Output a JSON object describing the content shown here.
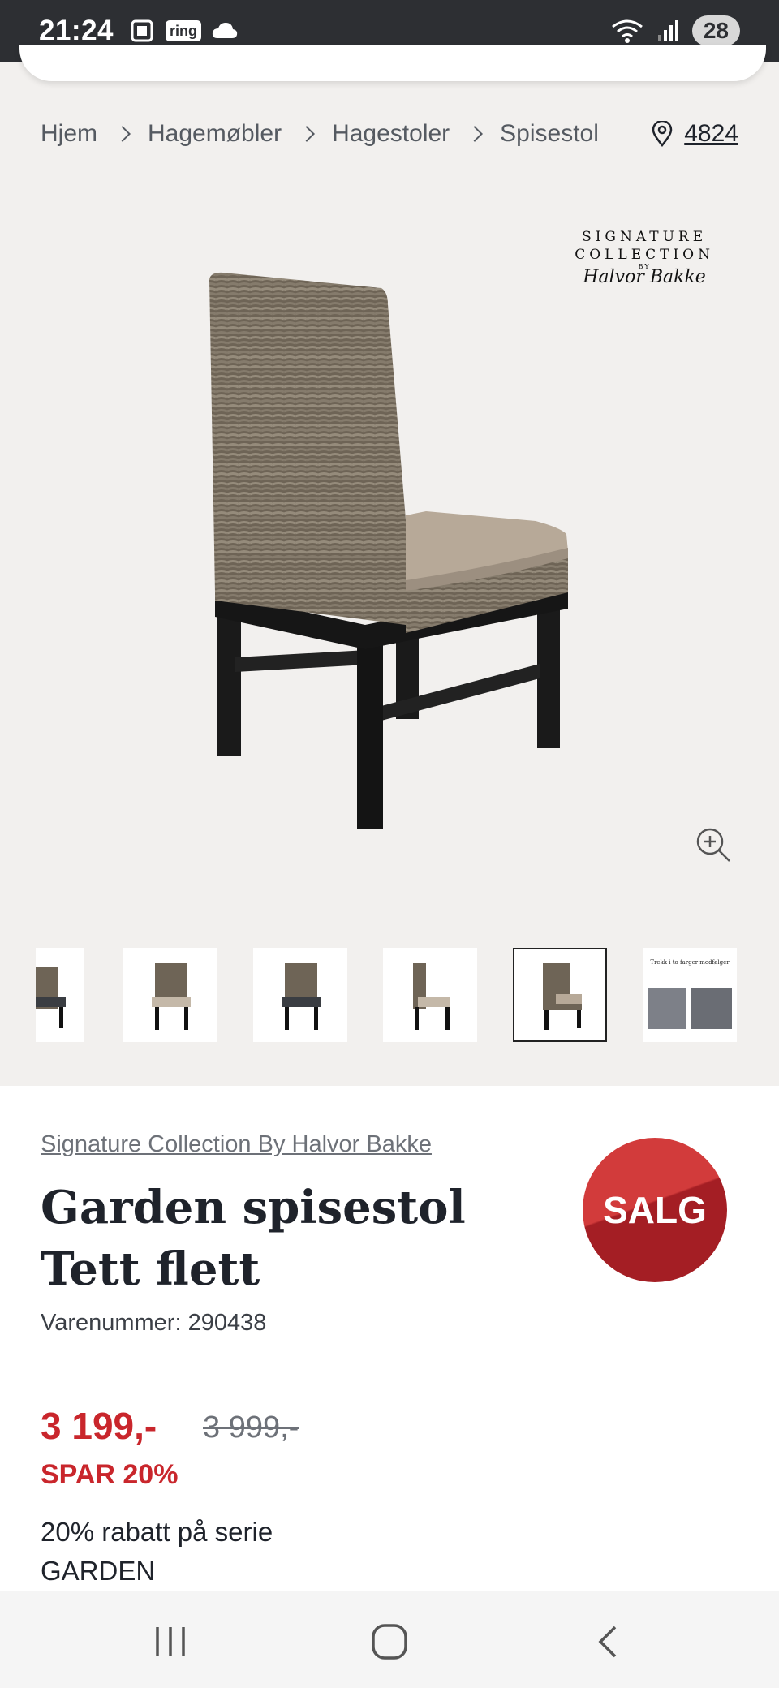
{
  "status_bar": {
    "time": "21:24",
    "ring_label": "ring",
    "battery": "28"
  },
  "breadcrumb": {
    "items": [
      "Hjem",
      "Hagemøbler",
      "Hagestoler",
      "Spisestol"
    ],
    "store_number": "4824"
  },
  "brand_logo": {
    "line1": "SIGNATURE",
    "line2": "COLLECTION",
    "line3": "BY",
    "signature": "Halvor Bakke"
  },
  "thumbnails": {
    "count": 6,
    "active_index": 4,
    "last_caption": "Trekk i to farger medfølger"
  },
  "product": {
    "brand": "Signature Collection By Halvor Bakke",
    "title": "Garden spisestol Tett flett",
    "sku": "Varenummer: 290438",
    "badge": "SALG",
    "price": "3 199,-",
    "old_price": "3 999,-",
    "save": "SPAR 20%",
    "promo": "20% rabatt på serie GARDEN"
  },
  "colors": {
    "sale_red": "#c9262c",
    "status_bar": "#2d2f33"
  }
}
